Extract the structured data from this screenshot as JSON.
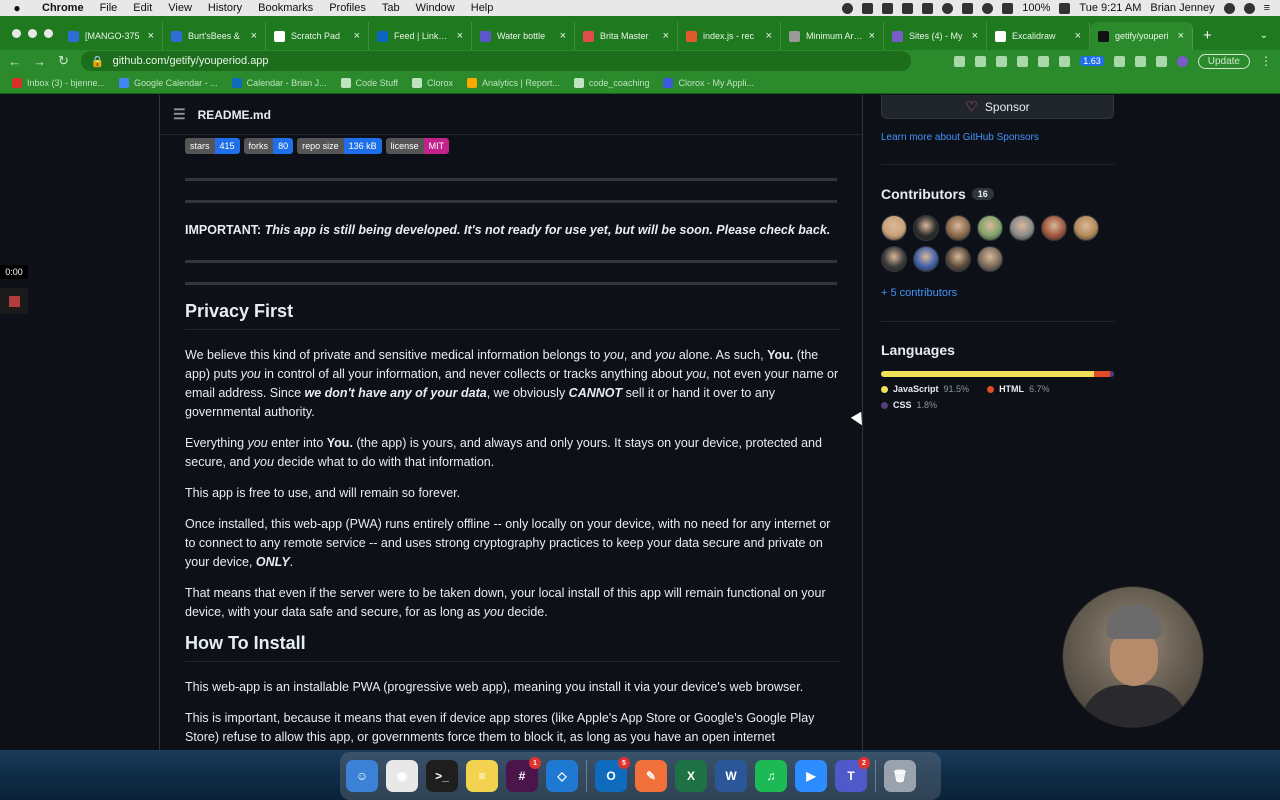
{
  "menubar": {
    "app_name": "Chrome",
    "menus": [
      "File",
      "Edit",
      "View",
      "History",
      "Bookmarks",
      "Profiles",
      "Tab",
      "Window",
      "Help"
    ],
    "battery": "100%",
    "datetime": "Tue 9:21 AM",
    "user": "Brian Jenney"
  },
  "tabs": [
    {
      "label": "[MANGO-375",
      "fav": "#2b6fd6"
    },
    {
      "label": "Burt'sBees &",
      "fav": "#2b6fd6"
    },
    {
      "label": "Scratch Pad",
      "fav": "#ffffff"
    },
    {
      "label": "Feed | LinkedI",
      "fav": "#0a66c2"
    },
    {
      "label": "Water bottle",
      "fav": "#5b57c9"
    },
    {
      "label": "Brita Master",
      "fav": "#e24b4b"
    },
    {
      "label": "index.js - rec",
      "fav": "#e05a2b"
    },
    {
      "label": "Minimum Area",
      "fav": "#9a9a9a"
    },
    {
      "label": "Sites (4) - My",
      "fav": "#7a5cc9"
    },
    {
      "label": "Excalidraw",
      "fav": "#ffffff"
    },
    {
      "label": "getify/youperi",
      "fav": "#111111",
      "active": true
    }
  ],
  "toolbar": {
    "url": "github.com/getify/youperiod.app",
    "extension_badge": "1.63",
    "update_label": "Update"
  },
  "bookmarks": [
    {
      "label": "Inbox (3) - bjenne...",
      "fav": "#d93025"
    },
    {
      "label": "Google Calendar - ...",
      "fav": "#4285f4"
    },
    {
      "label": "Calendar - Brian J...",
      "fav": "#0f6cbd"
    },
    {
      "label": "Code Stuff",
      "fav": "#bfe4bf"
    },
    {
      "label": "Clorox",
      "fav": "#bfe4bf"
    },
    {
      "label": "Analytics | Report...",
      "fav": "#f9ab00"
    },
    {
      "label": "code_coaching",
      "fav": "#bfe4bf"
    },
    {
      "label": "Clorox - My Appli...",
      "fav": "#3b5bdb"
    }
  ],
  "readme": {
    "filename": "README.md",
    "badges": [
      {
        "label": "stars",
        "value": "415",
        "color": "#1f6feb"
      },
      {
        "label": "forks",
        "value": "80",
        "color": "#1f6feb"
      },
      {
        "label": "repo size",
        "value": "136 kB",
        "color": "#1f6feb"
      },
      {
        "label": "license",
        "value": "MIT",
        "color": "#c2228a"
      }
    ],
    "important_label": "IMPORTANT:",
    "important_text": "This app is still being developed. It's not ready for use yet, but will be soon. Please check back.",
    "privacy_heading": "Privacy First",
    "p1": {
      "a": "We believe this kind of private and sensitive medical information belongs to ",
      "b": "you",
      "c": ", and ",
      "d": "you",
      "e": " alone. As such, ",
      "f": "You.",
      "g": " (the app) puts ",
      "h": "you",
      "i": " in control of all your information, and never collects or tracks anything about ",
      "j": "you",
      "k": ", not even your name or email address. Since ",
      "l": "we don't have any of your data",
      "m": ", we obviously ",
      "n": "CANNOT",
      "o": " sell it or hand it over to any governmental authority."
    },
    "p2": {
      "a": "Everything ",
      "b": "you",
      "c": " enter into ",
      "d": "You.",
      "e": " (the app) is yours, and always and only yours. It stays on your device, protected and secure, and ",
      "f": "you",
      "g": " decide what to do with that information."
    },
    "p3": "This app is free to use, and will remain so forever.",
    "p4": {
      "a": "Once installed, this web-app (PWA) runs entirely offline -- only locally on your device, with no need for any internet or to connect to any remote service -- and uses strong cryptography practices to keep your data secure and private on your device, ",
      "b": "ONLY",
      "c": "."
    },
    "p5": {
      "a": "That means that even if the server were to be taken down, your local install of this app will remain functional on your device, with your data safe and secure, for as long as ",
      "b": "you",
      "c": " decide."
    },
    "install_heading": "How To Install",
    "p6": "This web-app is an installable PWA (progressive web app), meaning you install it via your device's web browser.",
    "p7": "This is important, because it means that even if device app stores (like Apple's App Store or Google's Google Play Store) refuse to allow this app, or governments force them to block it, as long as you have an open internet"
  },
  "sidebar": {
    "sponsor_label": "Sponsor",
    "learn_more": "Learn more about GitHub Sponsors",
    "contributors_title": "Contributors",
    "contributors_count": "16",
    "avatar_colors": [
      "#c9a27a",
      "#2b2b2b",
      "#8a6a4a",
      "#7fa36a",
      "#8a8a8a",
      "#a0563c",
      "#b58a5a",
      "#3a3a3a",
      "#3d5fa8",
      "#5a4a3a",
      "#7a6a5a"
    ],
    "more_contributors": "+ 5 contributors",
    "languages_title": "Languages",
    "languages": [
      {
        "name": "JavaScript",
        "pct": "91.5%",
        "value": 91.5,
        "color": "#f1e05a"
      },
      {
        "name": "HTML",
        "pct": "6.7%",
        "value": 6.7,
        "color": "#e34c26"
      },
      {
        "name": "CSS",
        "pct": "1.8%",
        "value": 1.8,
        "color": "#563d7c"
      }
    ]
  },
  "overlay": {
    "timer": "0:00"
  },
  "dock": [
    {
      "name": "finder",
      "color": "#3b82d6",
      "glyph": "☺"
    },
    {
      "name": "chrome",
      "color": "#e8e8e8",
      "glyph": "◉"
    },
    {
      "name": "terminal",
      "color": "#1e1e1e",
      "glyph": ">_"
    },
    {
      "name": "notes",
      "color": "#f3d250",
      "glyph": "≡"
    },
    {
      "name": "slack",
      "color": "#4a154b",
      "glyph": "#",
      "badge": "1"
    },
    {
      "name": "vscode",
      "color": "#1f78d1",
      "glyph": "◇"
    },
    {
      "name": "outlook",
      "color": "#0f6cbd",
      "glyph": "O",
      "badge": "5"
    },
    {
      "name": "pencil",
      "color": "#f2703a",
      "glyph": "✎"
    },
    {
      "name": "excel",
      "color": "#1e7145",
      "glyph": "X"
    },
    {
      "name": "word",
      "color": "#2b579a",
      "glyph": "W"
    },
    {
      "name": "spotify",
      "color": "#1db954",
      "glyph": "♫"
    },
    {
      "name": "zoom",
      "color": "#2d8cff",
      "glyph": "▶"
    },
    {
      "name": "teams",
      "color": "#5059c9",
      "glyph": "T",
      "badge": "2"
    },
    {
      "name": "trash",
      "color": "#9aa3ad",
      "glyph": "🗑"
    }
  ]
}
